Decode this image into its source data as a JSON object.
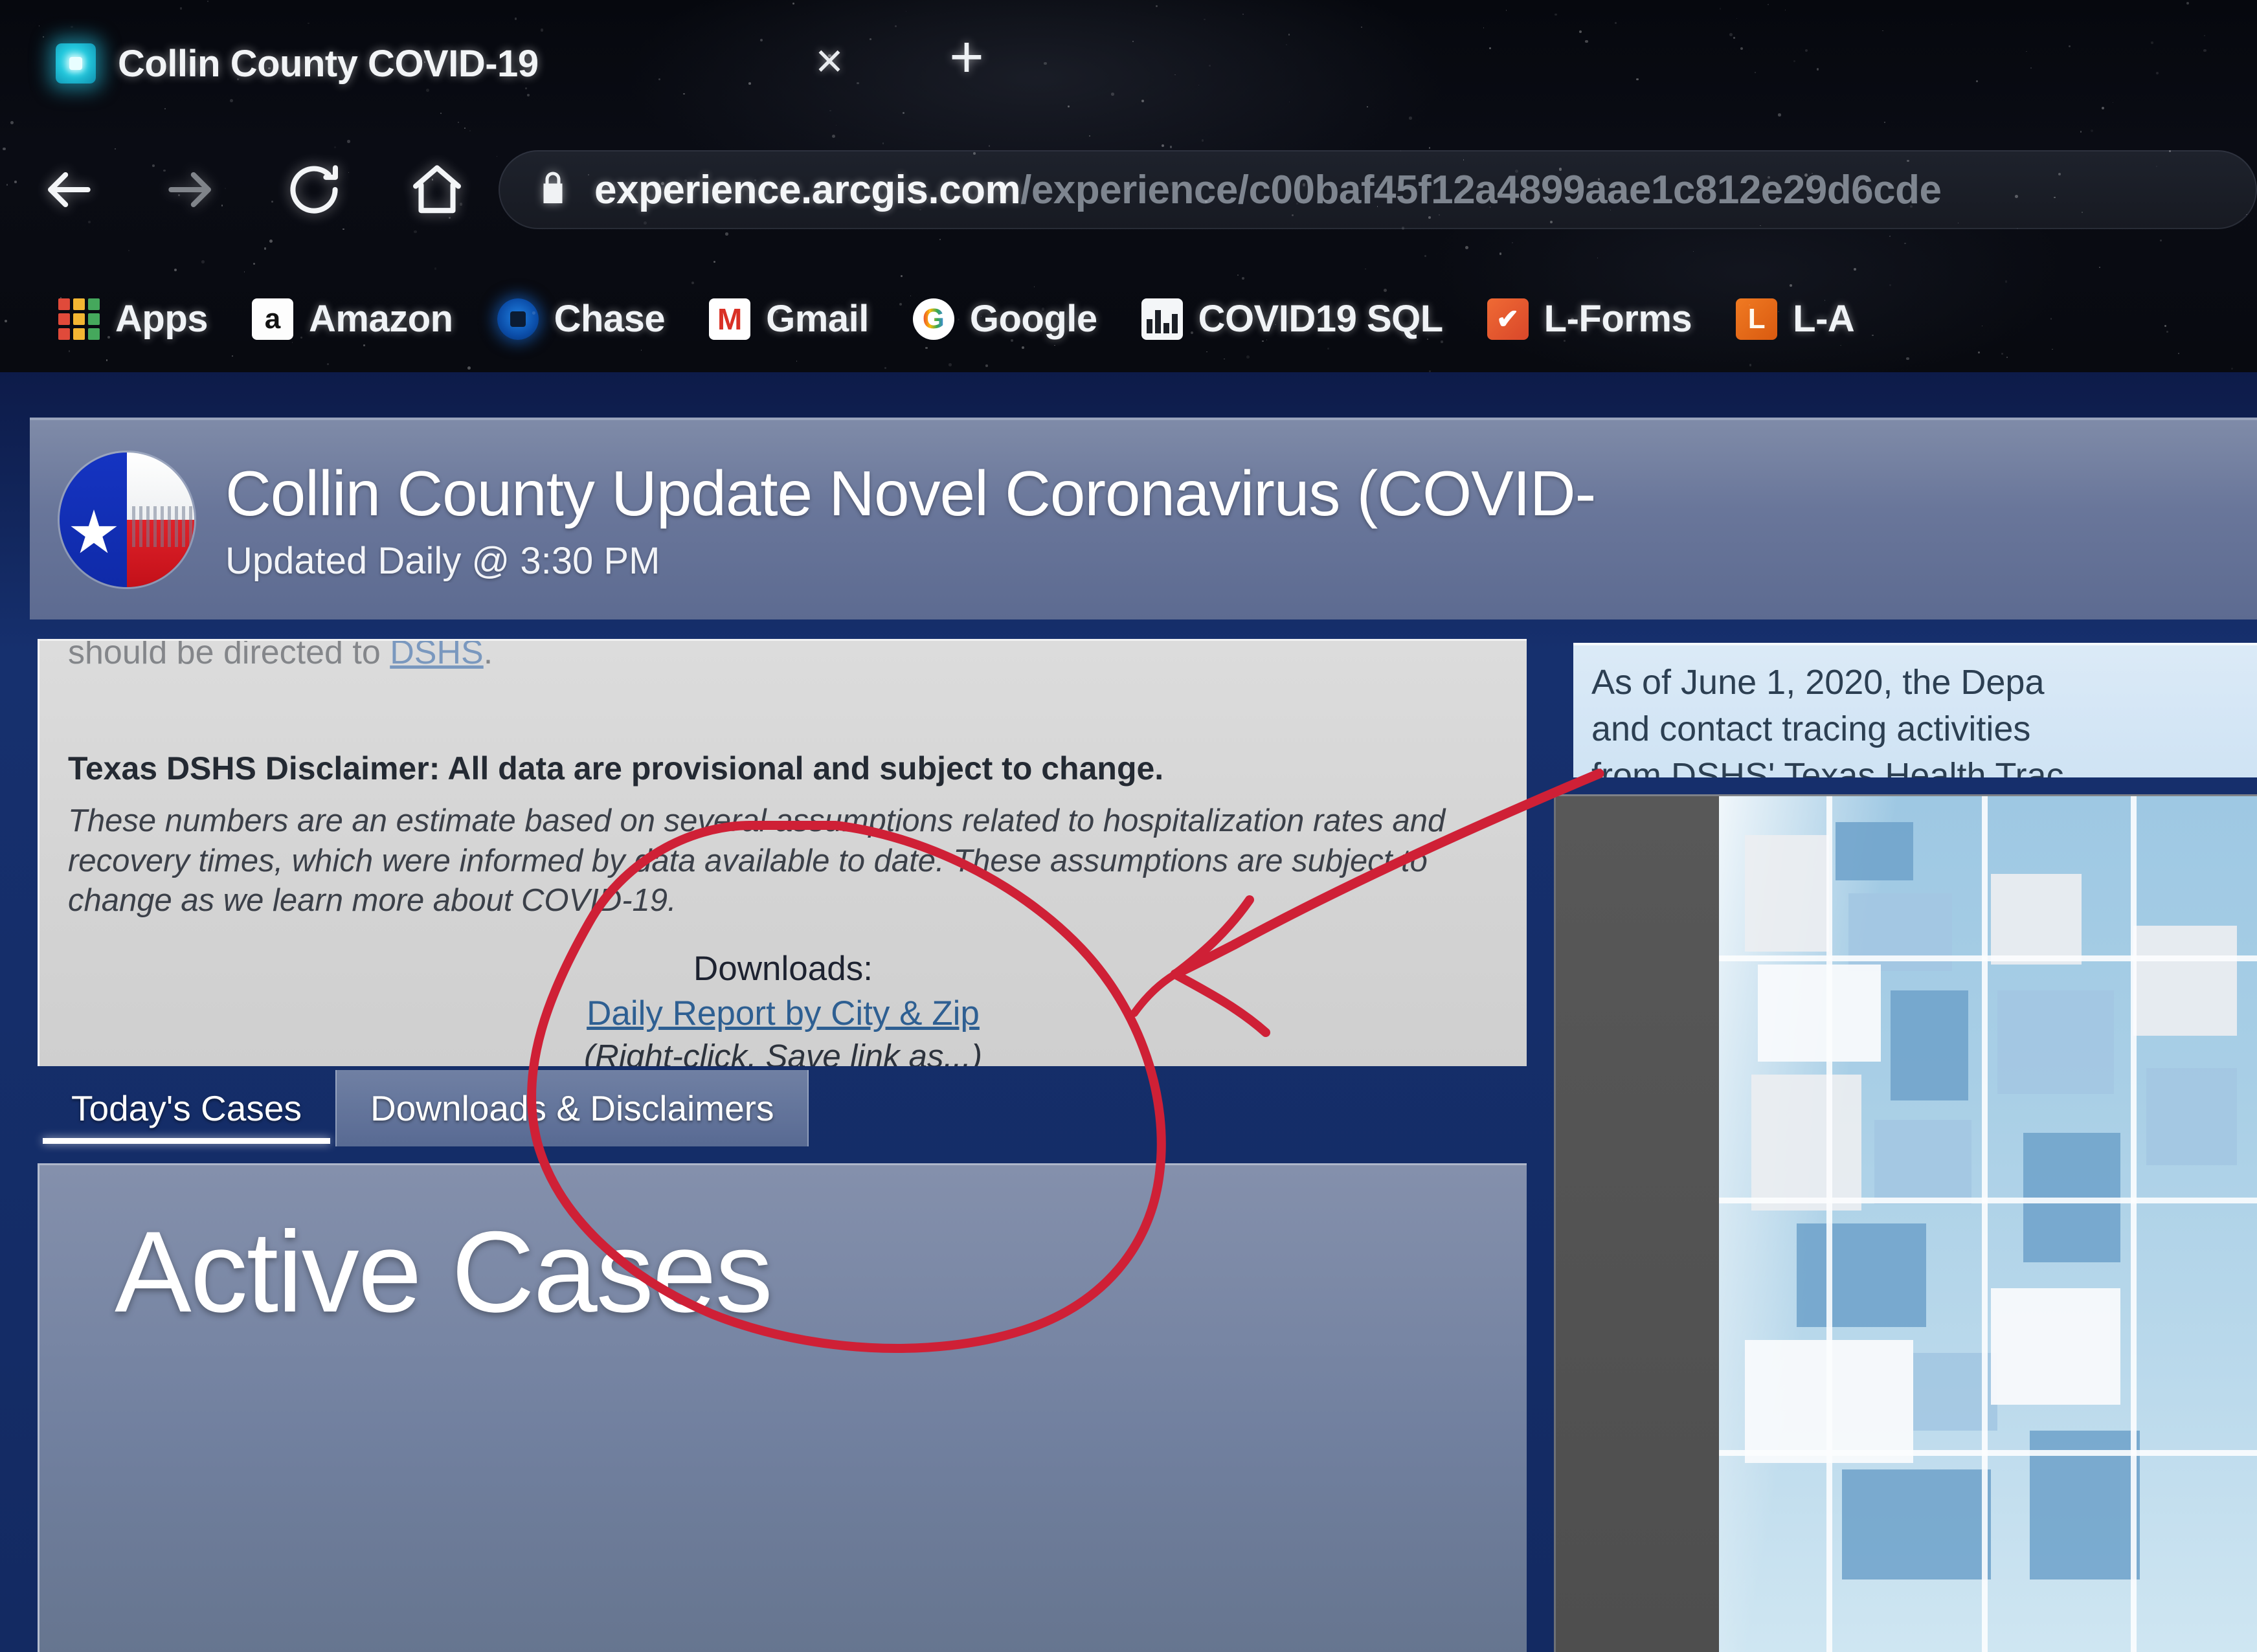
{
  "browser": {
    "tab": {
      "title": "Collin County COVID-19",
      "favicon_name": "arcgis-favicon",
      "close_glyph": "×",
      "newtab_glyph": "+"
    },
    "nav": {
      "back_name": "back-arrow-icon",
      "forward_name": "forward-arrow-icon",
      "reload_name": "reload-icon",
      "home_name": "home-icon"
    },
    "omnibox": {
      "lock_name": "lock-icon",
      "url_host": "experience.arcgis.com",
      "url_path": "/experience/c00baf45f12a4899aae1c812e29d6cde"
    },
    "bookmarks": [
      {
        "label": "Apps",
        "icon": "apps-grid-icon"
      },
      {
        "label": "Amazon",
        "icon": "amazon-icon",
        "glyph": "a"
      },
      {
        "label": "Chase",
        "icon": "chase-icon"
      },
      {
        "label": "Gmail",
        "icon": "gmail-icon",
        "glyph": "M"
      },
      {
        "label": "Google",
        "icon": "google-icon",
        "glyph": "G"
      },
      {
        "label": "COVID19 SQL",
        "icon": "sql-chart-icon"
      },
      {
        "label": "L-Forms",
        "icon": "lforms-check-icon",
        "glyph": "✔"
      },
      {
        "label": "L-A",
        "icon": "la-icon",
        "glyph": "L"
      }
    ]
  },
  "dashboard": {
    "header": {
      "logo_name": "texas-flag-circle-logo",
      "title": "Collin County Update Novel Coronavirus (COVID-",
      "subtitle": "Updated Daily @ 3:30 PM"
    },
    "left_card": {
      "clipped_line_prefix": "should be directed to ",
      "clipped_line_link": "DSHS",
      "clipped_line_suffix": ".",
      "disclaimer_title": "Texas DSHS Disclaimer: All data are provisional and subject to change.",
      "disclaimer_body": "These numbers are an estimate based on several assumptions related to hospitalization rates and recovery times, which were informed by data available to date. These assumptions are subject to change as we learn more about COVID-19.",
      "downloads_heading": "Downloads:",
      "downloads_link": "Daily Report by City & Zip",
      "downloads_note": "(Right-click, Save link as...)"
    },
    "tabs": [
      {
        "label": "Today's Cases",
        "active": true
      },
      {
        "label": "Downloads & Disclaimers",
        "active": false
      }
    ],
    "active_panel": {
      "title": "Active Cases"
    },
    "info_box": {
      "text": "As of June 1, 2020, the Depa\nand contact tracing activities\nfrom DSHS' Texas Health Trac"
    },
    "map": {
      "name": "collin-county-choropleth-map"
    }
  },
  "annotation": {
    "color": "#cf2036",
    "circle_name": "red-circle-annotation",
    "arrow_name": "red-arrow-annotation"
  },
  "colors": {
    "page_navy": "#16306e",
    "header_slate": "#69769a",
    "card_gray": "#d4d4d4",
    "info_blue": "#d3e6f5",
    "link_blue": "#2e5f92",
    "annotation_red": "#cf2036"
  }
}
